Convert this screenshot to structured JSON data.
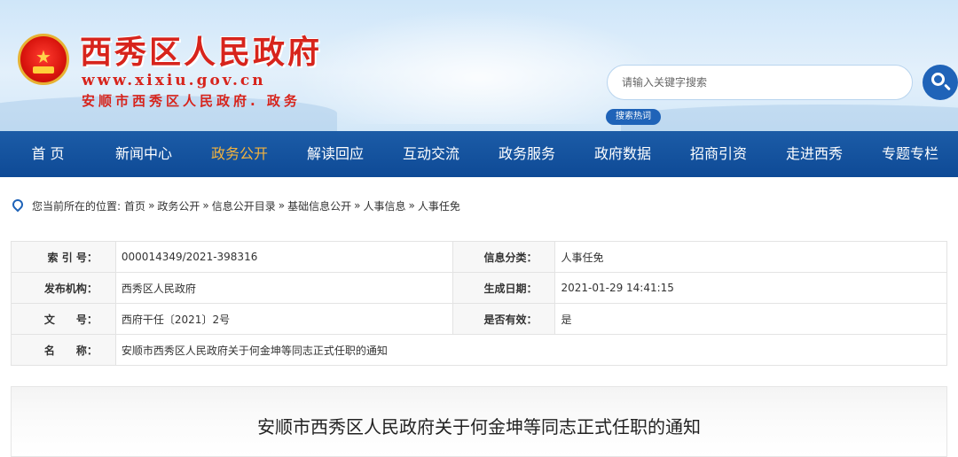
{
  "header": {
    "site_name": "西秀区人民政府",
    "domain": "www.xixiu.gov.cn",
    "subtitle": "安顺市西秀区人民政府. 政务",
    "search_placeholder": "请输入关键字搜索",
    "hot_label": "搜索热词",
    "emblem_icon": "national-emblem-icon",
    "search_icon": "search-icon"
  },
  "nav": {
    "items": [
      "首 页",
      "新闻中心",
      "政务公开",
      "解读回应",
      "互动交流",
      "政务服务",
      "政府数据",
      "招商引资",
      "走进西秀",
      "专题专栏"
    ],
    "active_index": 2
  },
  "breadcrumb": {
    "prefix": "您当前所在的位置:",
    "items": [
      "首页",
      "政务公开",
      "信息公开目录",
      "基础信息公开",
      "人事信息",
      "人事任免"
    ],
    "separator": "»",
    "icon": "location-pin-icon"
  },
  "info": {
    "index_label": "索 引 号：",
    "index_value": "000014349/2021-398316",
    "category_label": "信息分类：",
    "category_value": "人事任免",
    "publisher_label": "发布机构：",
    "publisher_value": "西秀区人民政府",
    "date_label": "生成日期：",
    "date_value": "2021-01-29 14:41:15",
    "docno_label": "文　　号：",
    "docno_value": "西府干任〔2021〕2号",
    "valid_label": "是否有效：",
    "valid_value": "是",
    "name_label": "名　　称：",
    "name_value": "安顺市西秀区人民政府关于何金坤等同志正式任职的通知"
  },
  "article": {
    "title": "安顺市西秀区人民政府关于何金坤等同志正式任职的通知"
  },
  "colors": {
    "brand_red": "#d7241c",
    "nav_blue": "#0e4a96",
    "nav_active": "#f4b33d",
    "button_blue": "#1f63b8"
  }
}
